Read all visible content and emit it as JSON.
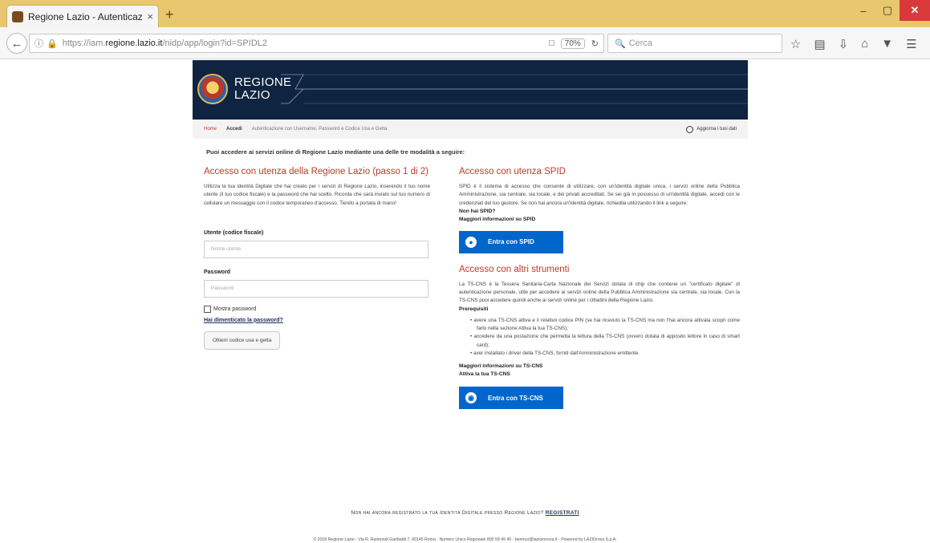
{
  "browser": {
    "tab_title": "Regione Lazio - Autenticazi",
    "tab_close": "×",
    "new_tab": "+",
    "url_prefix": "https://iam.",
    "url_domain": "regione.lazio.it",
    "url_path": "/nidp/app/login?id=SPIDL2",
    "zoom": "70%",
    "search_placeholder": "Cerca",
    "window_min": "–",
    "window_max": "▢",
    "window_close": "✕"
  },
  "banner": {
    "brand_line1": "REGIONE",
    "brand_line2": "LAZIO"
  },
  "breadcrumb": {
    "home": "Home",
    "item2": "Accedi",
    "item3": "Autenticazione con Username, Password e Codice Usa e Getta",
    "user_link": "Aggiorna i tuoi dati"
  },
  "intro": "Puoi accedere ai servizi online di Regione Lazio mediante una delle tre modalità a seguire:",
  "left": {
    "title": "Accesso con utenza della Regione Lazio (passo 1 di 2)",
    "description": "Utilizza la tua identità Digitale che hai creato per i servizi di Regione Lazio, inserendo il tuo nome utente (il tuo codice fiscale) e la password che hai scelto. Ricorda che sarà inviato sul tuo numero di cellulare un messaggio con il codice temporaneo d'accesso. Tienilo a portata di mano!",
    "username_label": "Utente (codice fiscale)",
    "username_placeholder": "Nome utente",
    "password_label": "Password",
    "password_placeholder": "Password",
    "show_password": "Mostra password",
    "forgot_password": "Hai dimenticato la password?",
    "otp_button": "Ottieni codice usa e getta"
  },
  "spid": {
    "title": "Accesso con utenza SPID",
    "description": "SPID è il sistema di accesso che consente di utilizzare, con un'identità digitale unica, i servizi online della Pubblica Amministrazione, sia centrale, sia locale, e dei privati accreditati. Se sei già in possesso di un'identità digitale, accedi con le credenziali del tuo gestore. Se non hai ancora un'identità digitale, richiedila utilizzando il link a seguire:",
    "no_spid": "Non hai SPID?",
    "more_info": "Maggiori informazioni su SPID",
    "button": "Entra con SPID"
  },
  "other": {
    "title": "Accesso con altri strumenti",
    "description": "La TS-CNS è la Tessera Sanitaria-Carta Nazionale dei Servizi dotata di chip che contiene un \"certificato digitale\" di autenticazione personale, utile per accedere ai servizi online della Pubblica Amministrazione sia centrale, sia locale. Con la TS-CNS puoi accedere quindi anche ai servizi online per i cittadini della Regione Lazio.",
    "prereq_title": "Prerequisiti",
    "prerequisites": [
      "avere una TS-CNS attiva e il relativo codice PIN (se hai ricevuto la TS-CNS ma non l'hai ancora attivata scopri come farlo nella sezione Attiva la tua TS-CNS);",
      "accedere da una postazione che permetta la lettura della TS-CNS (ovvero dotata di apposito lettore in caso di smart card);",
      "aver installato i driver della TS-CNS, forniti dall'Amministrazione emittente."
    ],
    "more_info": "Maggiori informazioni su TS-CNS",
    "activate": "Attiva la tua TS-CNS",
    "button": "Entra con TS-CNS"
  },
  "footer": {
    "register_text": "Non hai ancora registrato la tua Identità Digitale presso Regione Lazio?",
    "register_link": "REGISTRATI",
    "copyright": "© 2018 Regione Lazio - Via R. Raimondi Garibaldi 7, 00145 Roma - Numero Unico Regionale 800 59 49 45 - benmur@lazioinnova.it - Powered by LAZIOcrea S.p.A."
  },
  "colors": {
    "banner_bg": "#0f2440",
    "accent_red": "#c0392b",
    "spid_blue": "#0066cc"
  }
}
